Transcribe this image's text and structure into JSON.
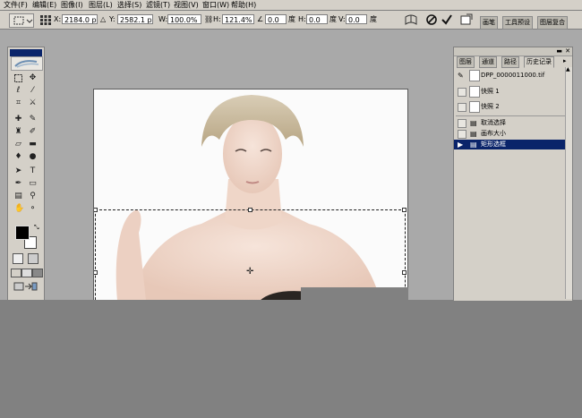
{
  "menu": {
    "items": [
      "文件(F)",
      "编辑(E)",
      "图像(I)",
      "图层(L)",
      "选择(S)",
      "滤镜(T)",
      "视图(V)",
      "窗口(W)",
      "帮助(H)"
    ]
  },
  "options": {
    "x_label": "X:",
    "x_value": "2184.0 px",
    "y_label": "Y:",
    "y_value": "2582.1 px",
    "w_label": "W:",
    "w_value": "100.0%",
    "h_label": "H:",
    "h_value": "121.4%",
    "angle_value": "0.0",
    "angle_unit": "度",
    "hskew_label": "H:",
    "hskew_value": "0.0",
    "hskew_unit": "度",
    "vskew_label": "V:",
    "vskew_value": "0.0",
    "vskew_unit": "度"
  },
  "palette_well": [
    "画笔",
    "工具预设",
    "图层复合"
  ],
  "history_panel": {
    "tabs": [
      "图层",
      "通道",
      "路径",
      "历史记录"
    ],
    "snapshot_name": "DPP_0000011000.tif",
    "snapshots": [
      "快照 1",
      "快照 2"
    ],
    "states": [
      "取消选择",
      "画布大小",
      "矩形选框"
    ]
  },
  "colors": {
    "ui_gray": "#d4d0c8",
    "workspace": "#a9a9a9",
    "selection_highlight": "#0a246a"
  }
}
